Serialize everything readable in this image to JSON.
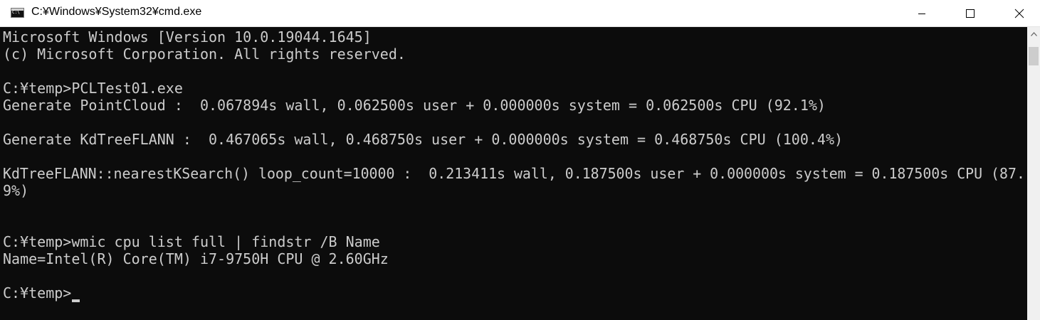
{
  "window": {
    "title": "C:¥Windows¥System32¥cmd.exe",
    "app_icon": "cmd-icon",
    "controls": [
      "minimize-icon",
      "maximize-icon",
      "close-icon"
    ]
  },
  "console": {
    "lines": [
      "Microsoft Windows [Version 10.0.19044.1645]",
      "(c) Microsoft Corporation. All rights reserved.",
      "C:¥temp>PCLTest01.exe",
      "Generate PointCloud :  0.067894s wall, 0.062500s user + 0.000000s system = 0.062500s CPU (92.1%)",
      "Generate KdTreeFLANN :  0.467065s wall, 0.468750s user + 0.000000s system = 0.468750s CPU (100.4%)",
      "KdTreeFLANN::nearestKSearch() loop_count=10000 :  0.213411s wall, 0.187500s user + 0.000000s system = 0.187500s CPU (87.",
      "9%)",
      "C:¥temp>wmic cpu list full | findstr /B Name",
      "Name=Intel(R) Core(TM) i7-9750H CPU @ 2.60GHz",
      "C:¥temp>"
    ]
  },
  "colors": {
    "console_bg": "#0c0c0c",
    "console_fg": "#cccccc",
    "titlebar_bg": "#ffffff"
  }
}
